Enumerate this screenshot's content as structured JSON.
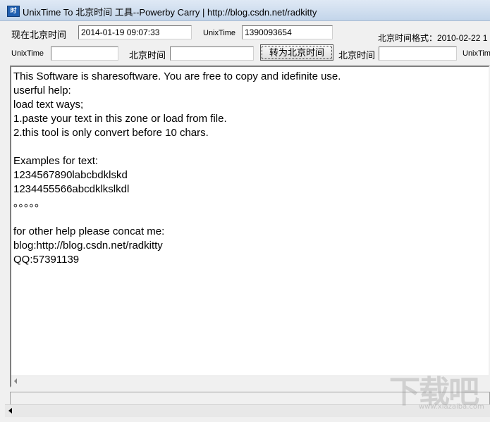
{
  "window": {
    "title": "UnixTime To 北京时间 工具--Powerby Carry |   http://blog.csdn.net/radkitty",
    "icon_name": "app-clock-icon",
    "icon_glyph": "时"
  },
  "row1": {
    "now_label": "现在北京时间",
    "now_value": "2014-01-19 09:07:33",
    "unix_label": "UnixTime",
    "unix_value": "1390093654",
    "format_label": "北京时间格式：2010-02-22 1"
  },
  "row2": {
    "unix_label": "UnixTime",
    "unix_value": "",
    "beijing_label": "北京时间",
    "beijing_value": "",
    "convert_button": "转为北京时间",
    "beijing_label2": "北京时间",
    "beijing_value2": "",
    "unix_label2": "UnixTim"
  },
  "textarea": {
    "content": "This Software is sharesoftware. You are free to copy and idefinite use.\nuserful help:\nload text ways;\n1.paste your text in this zone or load from file.\n2.this tool is only convert before 10 chars.\n\nExamples for text:\n1234567890labcbdklskd\n1234455566abcdklkslkdl\n。。。。。\n\nfor other help please concat me:\nblog:http://blog.csdn.net/radkitty\nQQ:57391139"
  },
  "watermark": {
    "text": "下载吧",
    "sub": "www.xiazaiba.com"
  }
}
